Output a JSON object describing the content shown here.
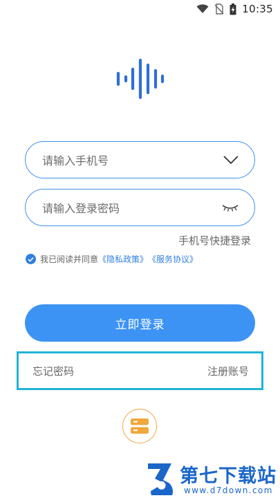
{
  "status_bar": {
    "time": "10:35",
    "icons": [
      "wifi-icon",
      "no-sim-icon",
      "battery-charging-icon"
    ]
  },
  "login_form": {
    "phone_placeholder": "请输入手机号",
    "password_placeholder": "请输入登录密码",
    "phone_icon": "chevron-down-icon",
    "password_icon": "eye-closed-icon",
    "quick_login_label": "手机号快捷登录",
    "agreement": {
      "checked": true,
      "prefix": "我已阅读并同意",
      "privacy_link": "《隐私政策》",
      "service_link": "《服务协议》"
    },
    "login_button_label": "立即登录"
  },
  "account_links": {
    "forgot_password": "忘记密码",
    "register": "注册账号"
  },
  "switch_button_icon": "server-switch-icon",
  "watermark": {
    "brand": "第七下载站",
    "url": "www.d7down.com"
  },
  "colors": {
    "accent": "#3d93f4",
    "link": "#2f7fe0",
    "highlight_box": "#1fb3d8",
    "switch_button": "#f0a73c",
    "watermark": "#1a66c9"
  }
}
